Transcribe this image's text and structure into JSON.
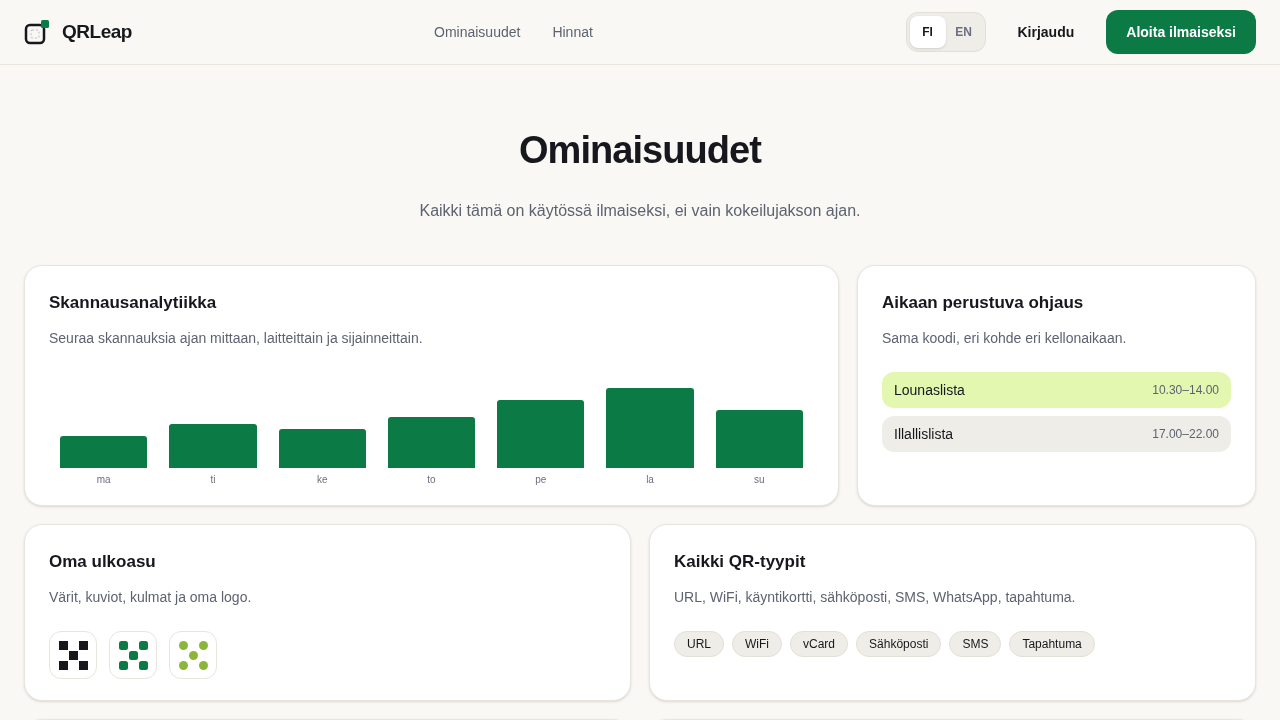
{
  "header": {
    "brand": "QRLeap",
    "nav": [
      {
        "label": "Ominaisuudet"
      },
      {
        "label": "Hinnat"
      }
    ],
    "languages": [
      {
        "label": "FI",
        "selected": true
      },
      {
        "label": "EN",
        "selected": false
      }
    ],
    "login": "Kirjaudu",
    "cta": "Aloita ilmaiseksi"
  },
  "hero": {
    "title": "Ominaisuudet",
    "subtitle": "Kaikki tämä on käytössä ilmaiseksi, ei vain kokeilujakson ajan."
  },
  "analytics": {
    "title": "Skannausanalytiikka",
    "description": "Seuraa skannauksia ajan mittaan, laitteittain ja sijainneittain.",
    "days": [
      "ma",
      "ti",
      "ke",
      "to",
      "pe",
      "la",
      "su"
    ]
  },
  "scheduling": {
    "title": "Aikaan perustuva ohjaus",
    "description": "Sama koodi, eri kohde eri kellonaikaan.",
    "slots": [
      {
        "label": "Lounaslista",
        "time": "10.30–14.00",
        "active": true
      },
      {
        "label": "Illallislista",
        "time": "17.00–22.00",
        "active": false
      }
    ]
  },
  "branding": {
    "title": "Oma ulkoasu",
    "description": "Värit, kuviot, kulmat ja oma logo.",
    "styles": [
      {
        "kind": "square",
        "color": "#16181d"
      },
      {
        "kind": "rounded",
        "color": "#0b7a45"
      },
      {
        "kind": "dot",
        "color": "#8db53c"
      }
    ]
  },
  "types": {
    "title": "Kaikki QR-tyypit",
    "description": "URL, WiFi, käyntikortti, sähköposti, SMS, WhatsApp, tapahtuma.",
    "tags": [
      "URL",
      "WiFi",
      "vCard",
      "Sähköposti",
      "SMS",
      "Tapahtuma"
    ]
  }
}
